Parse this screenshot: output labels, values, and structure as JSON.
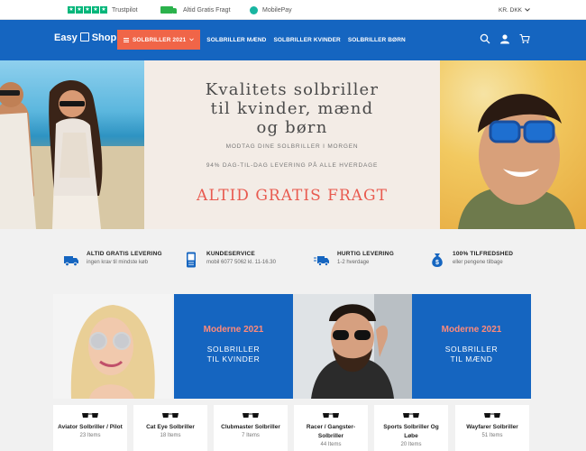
{
  "topbar": {
    "trustpilot": "Trustpilot",
    "shipping": "Altid Gratis Fragt",
    "payment": "MobilePay",
    "currency": "KR. DKK"
  },
  "header": {
    "logo_left": "Easy",
    "logo_right": "Shop",
    "nav": [
      "SOLBRILLER 2021",
      "SOLBRILLER MÆND",
      "SOLBRILLER KVINDER",
      "SOLBRILLER BØRN"
    ],
    "icons": [
      "search-icon",
      "user-icon",
      "cart-icon"
    ],
    "cart_count": "0"
  },
  "hero": {
    "title_lines": [
      "Kvalitets solbriller",
      "til kvinder, mænd",
      "og børn"
    ],
    "subtitle1": "MODTAG DINE SOLBRILLER I MORGEN",
    "subtitle2": "94% DAG-TIL-DAG LEVERING PÅ ALLE HVERDAGE",
    "cta": "ALTID GRATIS FRAGT"
  },
  "features": [
    {
      "icon": "truck-icon",
      "title": "ALTID GRATIS LEVERING",
      "desc": "ingen krav til mindste køb"
    },
    {
      "icon": "phone-icon",
      "title": "KUNDESERVICE",
      "desc": "mobil 6077 5062  kl. 11-16.30"
    },
    {
      "icon": "fast-delivery-icon",
      "title": "HURTIG LEVERING",
      "desc": "1-2 hverdage"
    },
    {
      "icon": "money-bag-icon",
      "title": "100% TILFREDSHED",
      "desc": "eller pengene tilbage"
    }
  ],
  "banners": [
    {
      "title": "Moderne 2021",
      "line1": "SOLBRILLER",
      "line2": "TIL KVINDER"
    },
    {
      "title": "Moderne 2021",
      "line1": "SOLBRILLER",
      "line2": "TIL MÆND"
    }
  ],
  "categories": [
    {
      "name": "Aviator Solbriller / Pilot",
      "count": "23 Items"
    },
    {
      "name": "Cat Eye Solbriller",
      "count": "18 Items"
    },
    {
      "name": "Clubmaster Solbriller",
      "count": "7 Items"
    },
    {
      "name": "Racer / Gangster-Solbriller",
      "count": "44 Items"
    },
    {
      "name": "Sports Solbriller Og Løbe",
      "count": "20 Items"
    },
    {
      "name": "Wayfarer Solbriller",
      "count": "51 Items"
    }
  ],
  "colors": {
    "brand_blue": "#1565c0",
    "accent_coral": "#f06548",
    "cta_red": "#e85a4f"
  }
}
